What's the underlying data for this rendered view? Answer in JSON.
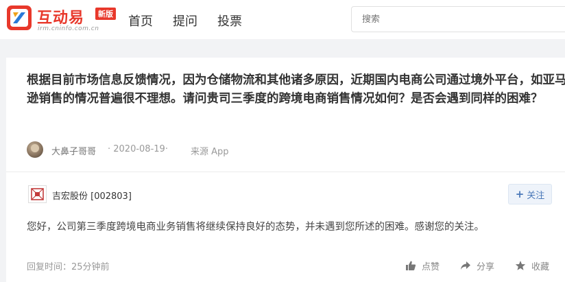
{
  "header": {
    "logo": {
      "title": "互动易",
      "badge": "新版",
      "subtitle": "irm.cninfo.com.cn",
      "brand_color": "#e8382b"
    },
    "nav": [
      {
        "label": "首页"
      },
      {
        "label": "提问"
      },
      {
        "label": "投票"
      }
    ],
    "search": {
      "placeholder": "搜索"
    }
  },
  "question": {
    "text": "根据目前市场信息反馈情况，因为仓储物流和其他诸多原因，近期国内电商公司通过境外平台，如亚马逊销售的情况普遍很不理想。请问贵司三季度的跨境电商销售情况如何？是否会遇到同样的困难？",
    "asker": "大鼻子哥哥",
    "date": "· 2020-08-19·",
    "source": "来源 App"
  },
  "answer": {
    "company": "吉宏股份 [002803]",
    "follow_label": "关注",
    "text": "您好，公司第三季度跨境电商业务销售将继续保持良好的态势，并未遇到您所述的困难。感谢您的关注。",
    "reply_time": "回复时间：25分钟前",
    "actions": {
      "like": "点赞",
      "share": "分享",
      "favorite": "收藏"
    }
  },
  "icons": {
    "logo_mark": "cninfo-logo-icon",
    "company_logo": "company-logo-icon",
    "like": "thumbs-up-icon",
    "share": "share-arrow-icon",
    "favorite": "star-icon"
  },
  "colors": {
    "accent": "#4a78b8",
    "page_bg": "#f2f3f5"
  }
}
